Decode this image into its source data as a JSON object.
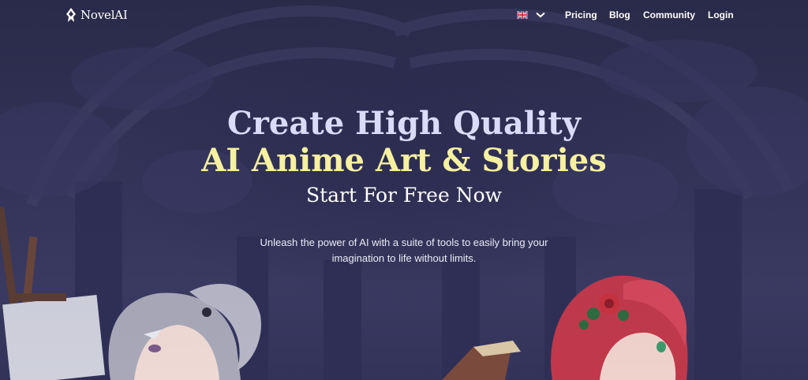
{
  "brand": {
    "name": "NovelAI",
    "logo_icon": "quill-icon"
  },
  "nav": {
    "language_icon": "uk-flag-icon",
    "language_chevron": "chevron-down-icon",
    "links": [
      "Pricing",
      "Blog",
      "Community",
      "Login"
    ]
  },
  "hero": {
    "line1": "Create High Quality",
    "line2": "AI Anime Art & Stories",
    "line3": "Start For Free Now",
    "description": "Unleash the power of AI with a suite of tools to easily bring your imagination to life without limits."
  },
  "colors": {
    "background": "#2c2c4c",
    "headline": "#d9dcf8",
    "accent": "#f5f1a0",
    "text": "#ffffff"
  }
}
